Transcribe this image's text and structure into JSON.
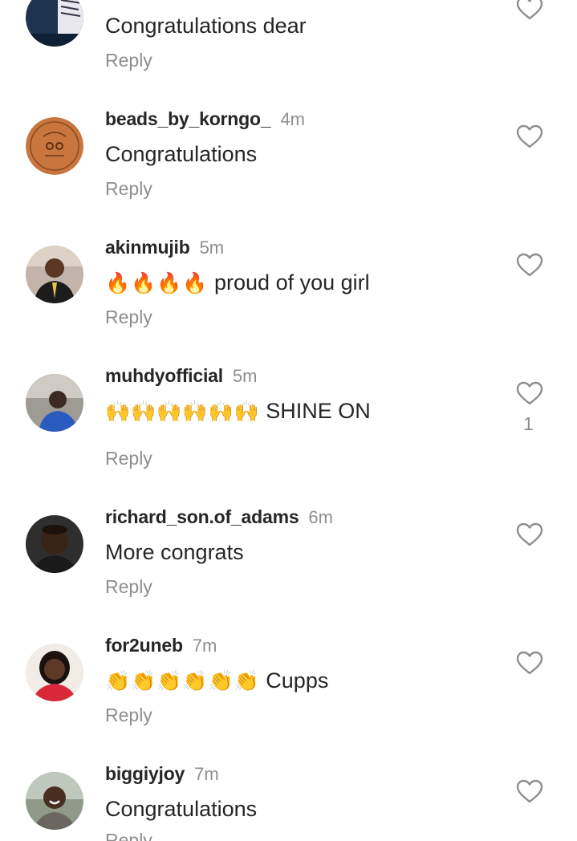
{
  "reply_label": "Reply",
  "comments": [
    {
      "username": "",
      "time": "",
      "emoji": "",
      "text": "Congratulations dear",
      "likes": "",
      "avatar_icon": "book-cover-avatar"
    },
    {
      "username": "beads_by_korngo_",
      "time": "4m",
      "emoji": "",
      "text": "Congratulations",
      "likes": "",
      "avatar_icon": "wooden-logo-avatar"
    },
    {
      "username": "akinmujib",
      "time": "5m",
      "emoji": "🔥🔥🔥🔥",
      "text": " proud of you girl",
      "likes": "",
      "avatar_icon": "person-avatar"
    },
    {
      "username": "muhdyofficial",
      "time": "5m",
      "emoji": "🙌🙌🙌🙌🙌🙌",
      "text": " SHINE ON",
      "likes": "1",
      "avatar_icon": "person-avatar"
    },
    {
      "username": "richard_son.of_adams",
      "time": "6m",
      "emoji": "",
      "text": "More congrats",
      "likes": "",
      "avatar_icon": "person-avatar"
    },
    {
      "username": "for2uneb",
      "time": "7m",
      "emoji": "👏👏👏👏👏👏",
      "text": " Cupps",
      "likes": "",
      "avatar_icon": "person-avatar"
    },
    {
      "username": "biggiyjoy",
      "time": "7m",
      "emoji": "",
      "text": "Congratulations",
      "likes": "",
      "avatar_icon": "person-avatar"
    }
  ],
  "colors": {
    "text": "#262626",
    "secondary": "#8e8e8e",
    "background": "#ffffff"
  },
  "icons": {
    "like": "heart-outline-icon"
  }
}
